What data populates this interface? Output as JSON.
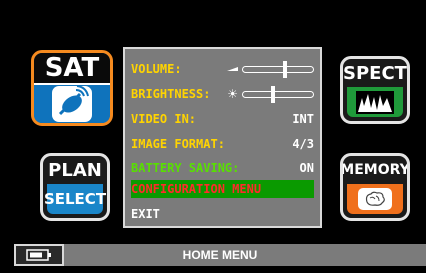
{
  "buttons": {
    "sat": {
      "label": "SAT"
    },
    "spect": {
      "label": "SPECT"
    },
    "plan": {
      "label": "PLAN",
      "sub_label": "SELECT"
    },
    "memory": {
      "label": "MEMORY"
    }
  },
  "menu": {
    "rows": [
      {
        "label": "VOLUME:",
        "control": "slider",
        "level": 0.6
      },
      {
        "label": "BRIGHTNESS:",
        "control": "slider",
        "level": 0.43
      },
      {
        "label": "VIDEO IN:",
        "value": "INT"
      },
      {
        "label": "IMAGE FORMAT:",
        "value": "4/3"
      },
      {
        "label": "BATTERY SAVING:",
        "value": "ON"
      },
      {
        "label": "CONFIGURATION MENU",
        "selected": true
      },
      {
        "label": "EXIT"
      }
    ]
  },
  "status_bar": {
    "title": "HOME MENU",
    "battery_icon": "battery-icon"
  },
  "colors": {
    "accent_orange": "#f58a1f",
    "menu_label_yellow": "#ffd400",
    "battery_green": "#58e000",
    "config_red": "#ff2b2b",
    "selected_green": "#0a9a00"
  }
}
